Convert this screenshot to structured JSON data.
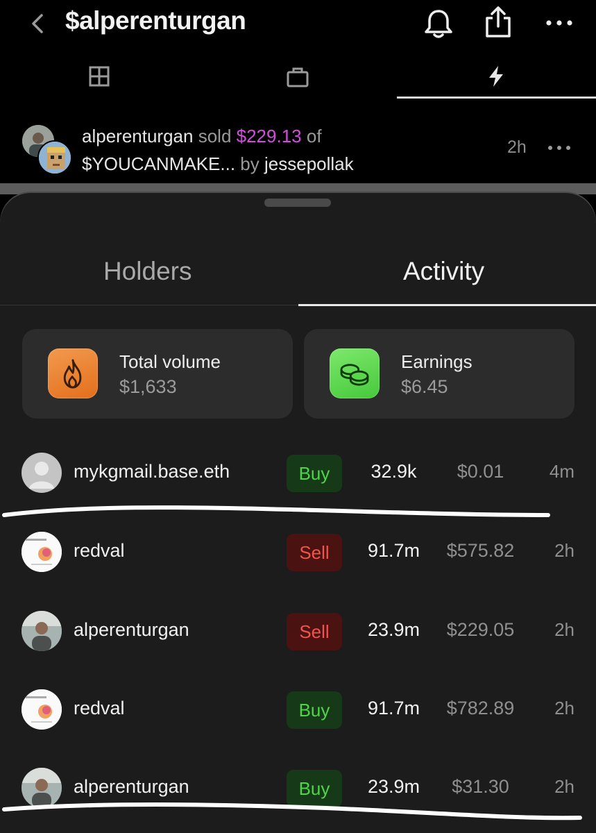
{
  "header": {
    "title": "$alperenturgan",
    "icons": [
      "chevron-left-icon",
      "bell-icon",
      "share-icon",
      "more-icon"
    ]
  },
  "nav_tabs": [
    {
      "icon": "grid-icon",
      "active": false
    },
    {
      "icon": "bag-icon",
      "active": false
    },
    {
      "icon": "lightning-icon",
      "active": true
    }
  ],
  "feed": {
    "user": "alperenturgan",
    "action": "sold",
    "amount": "$229.13",
    "of": "of",
    "token": "$YOUCANMAKE...",
    "by": "by",
    "creator": "jessepollak",
    "time": "2h",
    "accent_color": "#d24dde"
  },
  "sheet": {
    "tabs": [
      {
        "label": "Holders",
        "active": false
      },
      {
        "label": "Activity",
        "active": true
      }
    ],
    "stats": [
      {
        "label": "Total volume",
        "value": "$1,633",
        "icon": "fire-icon",
        "color": "#ec8430"
      },
      {
        "label": "Earnings",
        "value": "$6.45",
        "icon": "coins-icon",
        "color": "#5ad64a"
      }
    ],
    "activity": [
      {
        "user": "mykgmail.base.eth",
        "avatar": "default-avatar",
        "type": "Buy",
        "qty": "32.9k",
        "usd": "$0.01",
        "time": "4m"
      },
      {
        "user": "redval",
        "avatar": "redval-avatar",
        "type": "Sell",
        "qty": "91.7m",
        "usd": "$575.82",
        "time": "2h"
      },
      {
        "user": "alperenturgan",
        "avatar": "photo-avatar",
        "type": "Sell",
        "qty": "23.9m",
        "usd": "$229.05",
        "time": "2h"
      },
      {
        "user": "redval",
        "avatar": "redval-avatar",
        "type": "Buy",
        "qty": "91.7m",
        "usd": "$782.89",
        "time": "2h"
      },
      {
        "user": "alperenturgan",
        "avatar": "photo-avatar",
        "type": "Buy",
        "qty": "23.9m",
        "usd": "$31.30",
        "time": "2h"
      }
    ],
    "colors": {
      "buy": "#4fd44a",
      "sell": "#f0544c"
    }
  }
}
